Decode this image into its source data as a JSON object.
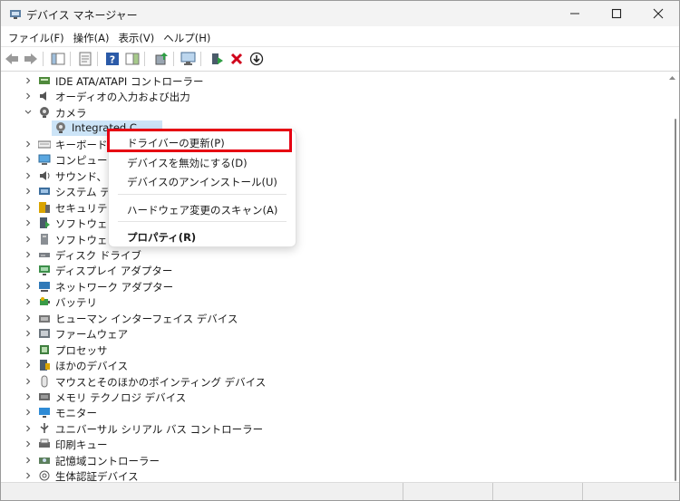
{
  "window": {
    "title": "デバイス マネージャー"
  },
  "menu": [
    "ファイル(F)",
    "操作(A)",
    "表示(V)",
    "ヘルプ(H)"
  ],
  "tree": [
    {
      "label": "IDE ATA/ATAPI コントローラー",
      "icon": "ide-controller-icon",
      "expanded": false
    },
    {
      "label": "オーディオの入力および出力",
      "icon": "speaker-icon",
      "expanded": false
    },
    {
      "label": "カメラ",
      "icon": "camera-icon",
      "expanded": true
    },
    {
      "label": "Integrated C",
      "icon": "webcam-icon",
      "child": true,
      "selected": true
    },
    {
      "label": "キーボード",
      "icon": "keyboard-icon",
      "expanded": false
    },
    {
      "label": "コンピュー",
      "icon": "computer-icon",
      "expanded": false
    },
    {
      "label": "サウンド、",
      "icon": "sound-icon",
      "expanded": false
    },
    {
      "label": "システム デ",
      "icon": "system-icon",
      "expanded": false
    },
    {
      "label": "セキュリテ",
      "icon": "security-icon",
      "expanded": false
    },
    {
      "label": "ソフトウェ",
      "icon": "software-component-icon",
      "expanded": false
    },
    {
      "label": "ソフトウェ",
      "icon": "software-device-icon",
      "expanded": false
    },
    {
      "label": "ディスク ドライブ",
      "icon": "disk-drive-icon",
      "expanded": false
    },
    {
      "label": "ディスプレイ アダプター",
      "icon": "display-adapter-icon",
      "expanded": false
    },
    {
      "label": "ネットワーク アダプター",
      "icon": "network-adapter-icon",
      "expanded": false
    },
    {
      "label": "バッテリ",
      "icon": "battery-icon",
      "expanded": false
    },
    {
      "label": "ヒューマン インターフェイス デバイス",
      "icon": "hid-icon",
      "expanded": false
    },
    {
      "label": "ファームウェア",
      "icon": "firmware-icon",
      "expanded": false
    },
    {
      "label": "プロセッサ",
      "icon": "processor-icon",
      "expanded": false
    },
    {
      "label": "ほかのデバイス",
      "icon": "other-devices-icon",
      "expanded": false
    },
    {
      "label": "マウスとそのほかのポインティング デバイス",
      "icon": "mouse-icon",
      "expanded": false
    },
    {
      "label": "メモリ テクノロジ デバイス",
      "icon": "memory-icon",
      "expanded": false
    },
    {
      "label": "モニター",
      "icon": "monitor-icon",
      "expanded": false
    },
    {
      "label": "ユニバーサル シリアル バス コントローラー",
      "icon": "usb-icon",
      "expanded": false
    },
    {
      "label": "印刷キュー",
      "icon": "printer-icon",
      "expanded": false
    },
    {
      "label": "記憶域コントローラー",
      "icon": "storage-controller-icon",
      "expanded": false
    },
    {
      "label": "生体認証デバイス",
      "icon": "biometric-icon",
      "expanded": false
    }
  ],
  "context_menu": {
    "update_driver": "ドライバーの更新(P)",
    "disable_device": "デバイスを無効にする(D)",
    "uninstall_device": "デバイスのアンインストール(U)",
    "scan_hardware": "ハードウェア変更のスキャン(A)",
    "properties": "プロパティ(R)"
  },
  "colors": {
    "highlight": "#e60012",
    "selection": "#cce4f7",
    "remove": "#d0021b"
  }
}
